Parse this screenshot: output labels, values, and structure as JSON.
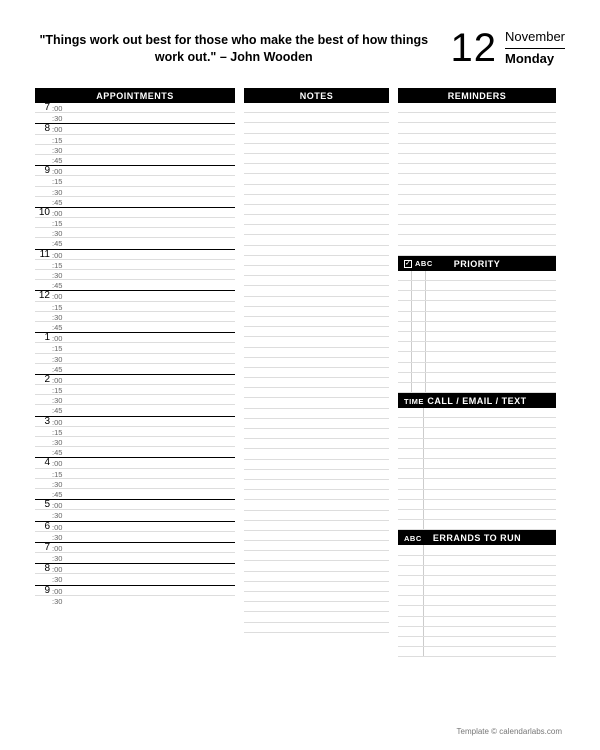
{
  "header": {
    "quote": "\"Things work out best for those who make the best of how things work out.\" – John Wooden",
    "day_number": "12",
    "month": "November",
    "weekday": "Monday"
  },
  "sections": {
    "appointments_title": "APPOINTMENTS",
    "notes_title": "NOTES",
    "reminders_title": "REMINDERS",
    "priority_title": "PRIORITY",
    "priority_sub": "ABC",
    "call_title": "CALL / EMAIL / TEXT",
    "call_sub": "TIME",
    "errands_title": "ERRANDS TO RUN",
    "errands_sub": "ABC"
  },
  "appointments": {
    "hours_full": [
      {
        "hour": "7",
        "minutes": [
          ":00",
          ":30"
        ]
      },
      {
        "hour": "8",
        "minutes": [
          ":00",
          ":15",
          ":30",
          ":45"
        ]
      },
      {
        "hour": "9",
        "minutes": [
          ":00",
          ":15",
          ":30",
          ":45"
        ]
      },
      {
        "hour": "10",
        "minutes": [
          ":00",
          ":15",
          ":30",
          ":45"
        ]
      },
      {
        "hour": "11",
        "minutes": [
          ":00",
          ":15",
          ":30",
          ":45"
        ]
      },
      {
        "hour": "12",
        "minutes": [
          ":00",
          ":15",
          ":30",
          ":45"
        ]
      },
      {
        "hour": "1",
        "minutes": [
          ":00",
          ":15",
          ":30",
          ":45"
        ]
      },
      {
        "hour": "2",
        "minutes": [
          ":00",
          ":15",
          ":30",
          ":45"
        ]
      },
      {
        "hour": "3",
        "minutes": [
          ":00",
          ":15",
          ":30",
          ":45"
        ]
      },
      {
        "hour": "4",
        "minutes": [
          ":00",
          ":15",
          ":30",
          ":45"
        ]
      },
      {
        "hour": "5",
        "minutes": [
          ":00",
          ":30"
        ]
      },
      {
        "hour": "6",
        "minutes": [
          ":00",
          ":30"
        ]
      },
      {
        "hour": "7",
        "minutes": [
          ":00",
          ":30"
        ]
      },
      {
        "hour": "8",
        "minutes": [
          ":00",
          ":30"
        ]
      },
      {
        "hour": "9",
        "minutes": [
          ":00",
          ":30"
        ]
      }
    ]
  },
  "layout": {
    "notes_lines": 52,
    "reminders_lines": 15,
    "priority_rows": 12,
    "call_rows": 12,
    "errands_rows": 11
  },
  "footer": "Template © calendarlabs.com"
}
